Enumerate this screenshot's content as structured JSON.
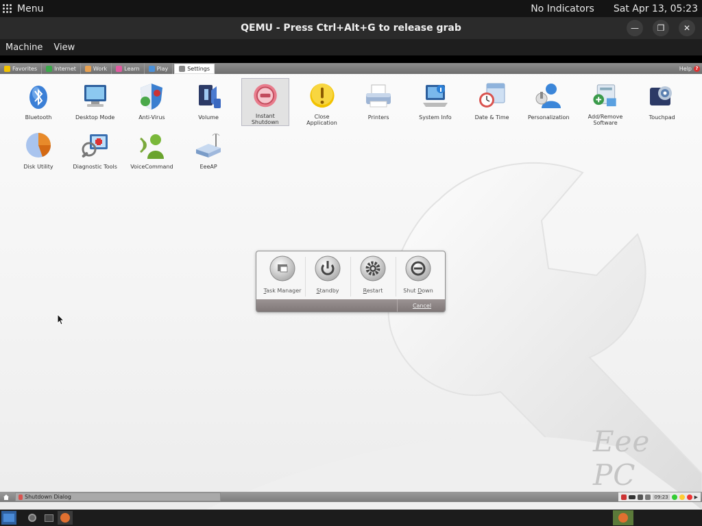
{
  "host_topbar": {
    "menu_label": "Menu",
    "indicators": "No Indicators",
    "datetime": "Sat Apr 13, 05:23"
  },
  "window": {
    "title": "QEMU - Press Ctrl+Alt+G to release grab",
    "menu": [
      "Machine",
      "View"
    ]
  },
  "tabs": [
    {
      "label": "Favorites",
      "color": "#f2c200",
      "active": false
    },
    {
      "label": "Internet",
      "color": "#3aa84a",
      "active": false
    },
    {
      "label": "Work",
      "color": "#e8a050",
      "active": false
    },
    {
      "label": "Learn",
      "color": "#e05aa0",
      "active": false
    },
    {
      "label": "Play",
      "color": "#4a90d9",
      "active": false
    },
    {
      "label": "Settings",
      "color": "#888888",
      "active": true
    }
  ],
  "help_label": "Help",
  "apps_row1": [
    {
      "label": "Bluetooth",
      "icon": "bluetooth-icon"
    },
    {
      "label": "Desktop Mode",
      "icon": "monitor-icon"
    },
    {
      "label": "Anti-Virus",
      "icon": "shield-icon"
    },
    {
      "label": "Volume",
      "icon": "volume-icon"
    },
    {
      "label": "Instant\nShutdown",
      "icon": "power-red-icon",
      "selected": true
    },
    {
      "label": "Close\nApplication",
      "icon": "warning-icon"
    },
    {
      "label": "Printers",
      "icon": "printer-icon"
    },
    {
      "label": "System Info",
      "icon": "laptop-info-icon"
    },
    {
      "label": "Date & Time",
      "icon": "calendar-clock-icon"
    },
    {
      "label": "Personalization",
      "icon": "person-icon"
    },
    {
      "label": "Add/Remove\nSoftware",
      "icon": "software-icon"
    },
    {
      "label": "Touchpad",
      "icon": "touchpad-icon"
    }
  ],
  "apps_row2": [
    {
      "label": "Disk Utility",
      "icon": "disk-pie-icon"
    },
    {
      "label": "Diagnostic Tools",
      "icon": "diagnostic-icon"
    },
    {
      "label": "VoiceCommand",
      "icon": "voice-icon"
    },
    {
      "label": "EeeAP",
      "icon": "router-icon"
    }
  ],
  "dialog": {
    "buttons": [
      {
        "label": "Task Manager",
        "accel": "T",
        "icon": "task-manager-icon"
      },
      {
        "label": "Standby",
        "accel": "S",
        "icon": "power-icon"
      },
      {
        "label": "Restart",
        "accel": "R",
        "icon": "gear-icon"
      },
      {
        "label": "Shut Down",
        "accel": "D",
        "icon": "shutdown-icon"
      }
    ],
    "cancel": "Cancel"
  },
  "watermark": "Eee PC",
  "guest_taskbar": {
    "task": "Shutdown Dialog",
    "clock": "09:23"
  }
}
